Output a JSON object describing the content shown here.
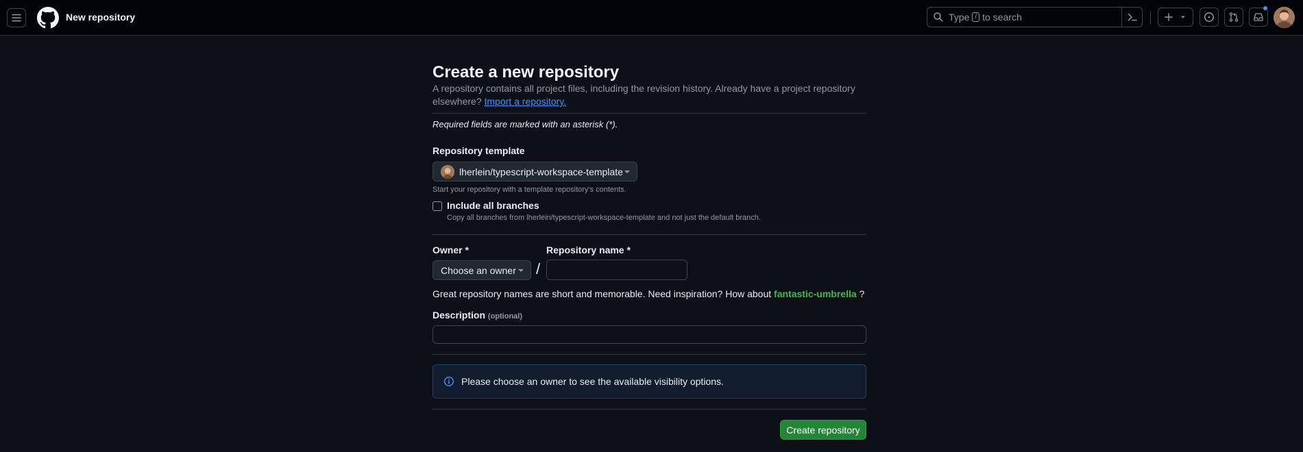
{
  "header": {
    "page_title": "New repository",
    "search": {
      "prefix": "Type",
      "key": "/",
      "suffix": "to search"
    }
  },
  "main": {
    "title": "Create a new repository",
    "intro": "A repository contains all project files, including the revision history. Already have a project repository elsewhere?",
    "import_link": "Import a repository.",
    "required_note": "Required fields are marked with an asterisk (*).",
    "template": {
      "label": "Repository template",
      "value": "lherlein/typescript-workspace-template",
      "hint": "Start your repository with a template repository's contents."
    },
    "branches": {
      "label": "Include all branches",
      "hint": "Copy all branches from lherlein/typescript-workspace-template and not just the default branch.",
      "checked": false
    },
    "owner": {
      "label": "Owner *",
      "value": "Choose an owner"
    },
    "slash": "/",
    "repo_name": {
      "label": "Repository name *",
      "value": ""
    },
    "suggestion": {
      "text": "Great repository names are short and memorable. Need inspiration? How about",
      "name": "fantastic-umbrella",
      "end": "?"
    },
    "description": {
      "label": "Description",
      "optional": "(optional)",
      "value": ""
    },
    "visibility_notice": "Please choose an owner to see the available visibility options.",
    "create_button": "Create repository"
  },
  "colors": {
    "accent": "#4493f8",
    "success": "#238636",
    "background": "#0d1117"
  }
}
